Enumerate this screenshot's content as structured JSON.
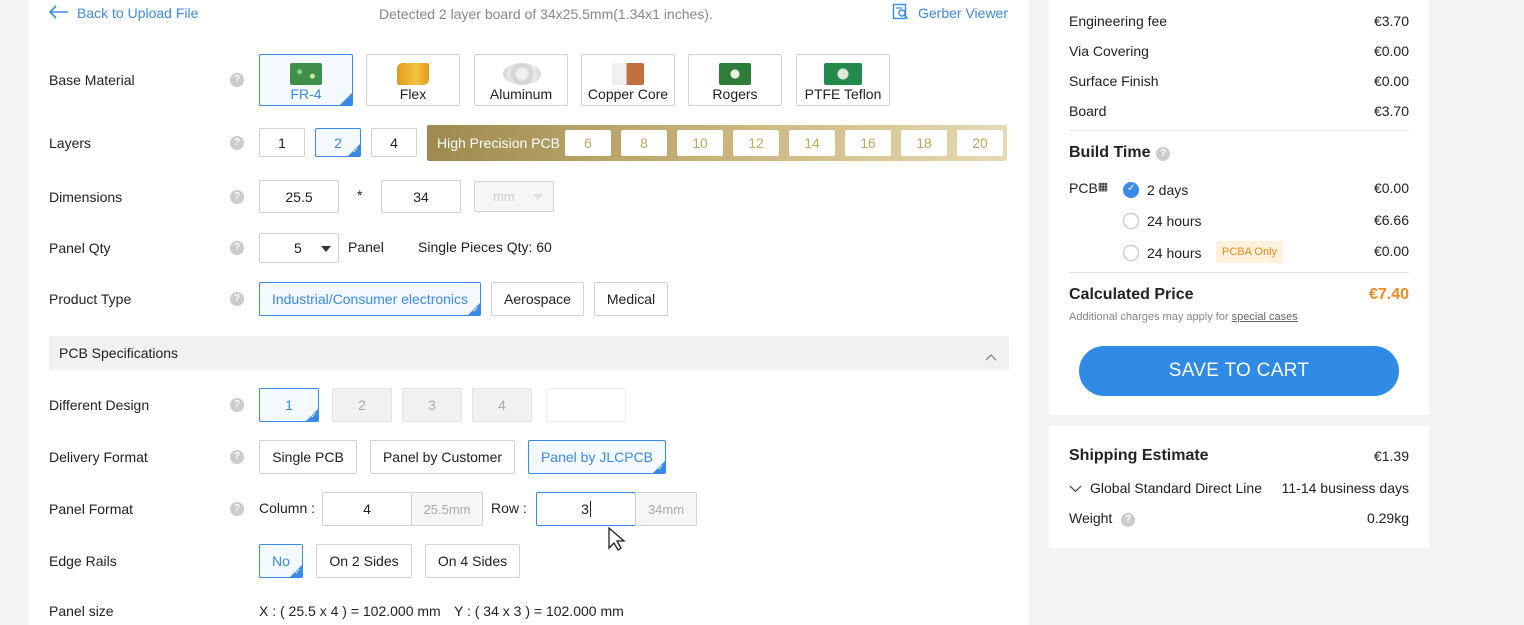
{
  "header": {
    "back_label": "Back to Upload File",
    "detected_text": "Detected 2 layer board of 34x25.5mm(1.34x1 inches).",
    "gerber_label": "Gerber Viewer"
  },
  "base_material": {
    "label": "Base Material",
    "options": [
      "FR-4",
      "Flex",
      "Aluminum",
      "Copper Core",
      "Rogers",
      "PTFE Teflon"
    ],
    "selected": "FR-4"
  },
  "layers": {
    "label": "Layers",
    "options": [
      "1",
      "2",
      "4"
    ],
    "selected": "2",
    "high_precision_label": "High Precision PCB",
    "high_precision_options": [
      "6",
      "8",
      "10",
      "12",
      "14",
      "16",
      "18",
      "20"
    ]
  },
  "dimensions": {
    "label": "Dimensions",
    "width": "25.5",
    "separator": "*",
    "height": "34",
    "unit": "mm"
  },
  "panel_qty": {
    "label": "Panel Qty",
    "value": "5",
    "unit_label": "Panel",
    "single_pieces": "Single Pieces Qty: 60"
  },
  "product_type": {
    "label": "Product Type",
    "options": [
      "Industrial/Consumer electronics",
      "Aerospace",
      "Medical"
    ],
    "selected": "Industrial/Consumer electronics"
  },
  "pcb_specs": {
    "title": "PCB Specifications"
  },
  "different_design": {
    "label": "Different Design",
    "options": [
      "1",
      "2",
      "3",
      "4"
    ],
    "selected": "1"
  },
  "delivery_format": {
    "label": "Delivery Format",
    "options": [
      "Single PCB",
      "Panel by Customer",
      "Panel by JLCPCB"
    ],
    "selected": "Panel by JLCPCB"
  },
  "panel_format": {
    "label": "Panel Format",
    "column_label": "Column :",
    "column_value": "4",
    "column_size": "25.5mm",
    "row_label": "Row :",
    "row_value": "3",
    "row_size": "34mm"
  },
  "edge_rails": {
    "label": "Edge Rails",
    "options": [
      "No",
      "On 2 Sides",
      "On 4 Sides"
    ],
    "selected": "No"
  },
  "panel_size": {
    "label": "Panel size",
    "x_text": "X : ( 25.5 x 4 ) = 102.000 mm",
    "y_text": "Y : ( 34 x 3 ) = 102.000 mm"
  },
  "pricing": {
    "rows": [
      {
        "label": "Engineering fee",
        "value": "€3.70"
      },
      {
        "label": "Via Covering",
        "value": "€0.00"
      },
      {
        "label": "Surface Finish",
        "value": "€0.00"
      },
      {
        "label": "Board",
        "value": "€3.70"
      }
    ],
    "build_time_title": "Build Time",
    "pcb_label": "PCB",
    "build_options": [
      {
        "label": "2 days",
        "value": "€0.00",
        "badge": ""
      },
      {
        "label": "24 hours",
        "value": "€6.66",
        "badge": ""
      },
      {
        "label": "24 hours",
        "value": "€0.00",
        "badge": "PCBA Only"
      }
    ],
    "calculated_label": "Calculated Price",
    "calculated_value": "€7.40",
    "note_prefix": "Additional charges may apply for ",
    "note_link": "special cases",
    "cart_label": "SAVE TO CART"
  },
  "shipping": {
    "title": "Shipping Estimate",
    "value": "€1.39",
    "method": "Global Standard Direct Line",
    "days": "11-14 business days",
    "weight_label": "Weight",
    "weight_value": "0.29kg"
  },
  "colors": {
    "accent": "#3a8be8",
    "price": "#f08a1c",
    "gold": "#c7a55a",
    "badge_bg": "#fff1dc"
  }
}
